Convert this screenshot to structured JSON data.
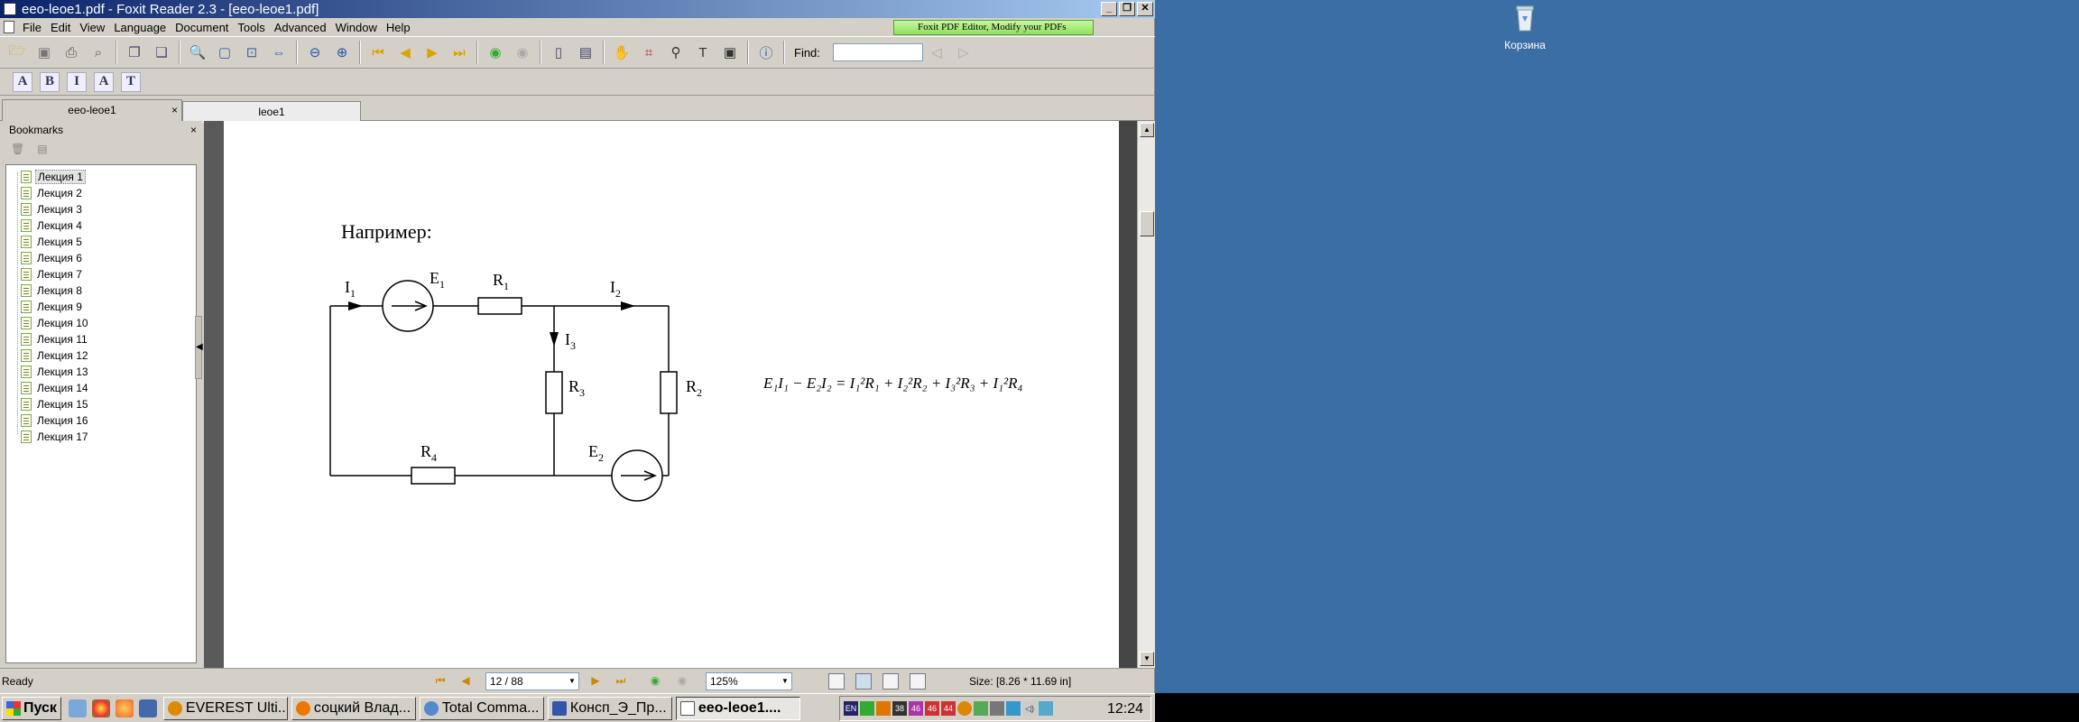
{
  "window": {
    "title": "eeo-leoe1.pdf - Foxit Reader 2.3 - [eeo-leoe1.pdf]"
  },
  "menu": [
    "File",
    "Edit",
    "View",
    "Language",
    "Document",
    "Tools",
    "Advanced",
    "Window",
    "Help"
  ],
  "promo": "Foxit PDF Editor, Modify your PDFs",
  "find": {
    "label": "Find:",
    "value": ""
  },
  "tabs": [
    {
      "label": "eeo-leoe1",
      "close": "×"
    },
    {
      "label": "leoe1"
    }
  ],
  "bookmarks": {
    "title": "Bookmarks",
    "close": "×",
    "items": [
      "Лекция 1",
      "Лекция 2",
      "Лекция 3",
      "Лекция 4",
      "Лекция 5",
      "Лекция 6",
      "Лекция 7",
      "Лекция 8",
      "Лекция 9",
      "Лекция 10",
      "Лекция 11",
      "Лекция 12",
      "Лекция 13",
      "Лекция 14",
      "Лекция 15",
      "Лекция 16",
      "Лекция 17"
    ],
    "selected": 0
  },
  "document": {
    "heading": "Например:",
    "labels": {
      "I1": "I",
      "I1_sub": "1",
      "E1": "E",
      "E1_sub": "1",
      "R1": "R",
      "R1_sub": "1",
      "I2": "I",
      "I2_sub": "2",
      "I3": "I",
      "I3_sub": "3",
      "R3": "R",
      "R3_sub": "3",
      "R2": "R",
      "R2_sub": "2",
      "R4": "R",
      "R4_sub": "4",
      "E2": "E",
      "E2_sub": "2"
    },
    "equation": "E₁I₁ − E₂I₂ = I₁²R₁ + I₂²R₂ + I₃²R₃ + I₁²R₄"
  },
  "status": {
    "ready": "Ready",
    "page": "12 / 88",
    "zoom": "125%",
    "size": "Size: [8.26 * 11.69 in]"
  },
  "desktop": {
    "recycle_bin": "Корзина"
  },
  "taskbar": {
    "start": "Пуск",
    "tasks": [
      "EVEREST Ulti...",
      "соцкий Влад...",
      "Total Comma...",
      "Консп_Э_Пр...",
      "eeo-leoe1...."
    ],
    "active_task": 4,
    "tray_numbers": [
      "38",
      "46",
      "46",
      "44"
    ],
    "lang": "EN",
    "clock": "12:24"
  },
  "colors": {
    "desktop": "#3a6ea5",
    "titlebar_start": "#0a246a",
    "titlebar_end": "#a6caf0",
    "promo_green": "#8fe060"
  }
}
